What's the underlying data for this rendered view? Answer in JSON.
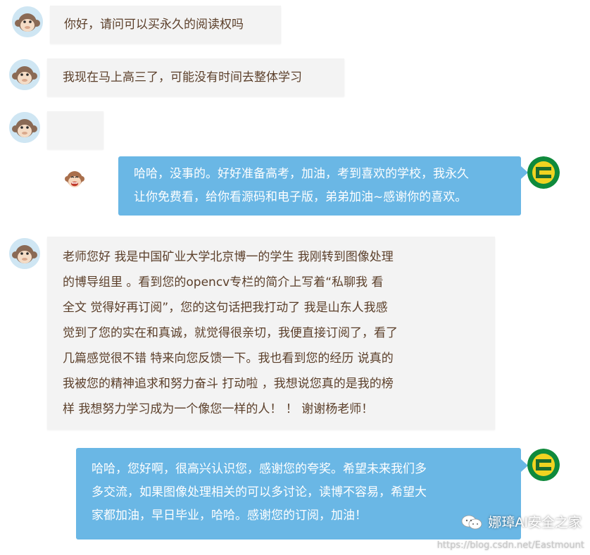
{
  "messages": [
    {
      "side": "in",
      "text": "你好，请问可以买永久的阅读权吗"
    },
    {
      "side": "in",
      "text": "我现在马上高三了，可能没有时间去整体学习"
    },
    {
      "side": "in",
      "text": "",
      "emoji": "monkey-face-emoji"
    },
    {
      "side": "out",
      "text": "哈哈，没事的。好好准备高考，加油，考到喜欢的学校，我永久\n让你免费看，给你看源码和电子版，弟弟加油~感谢你的喜欢。"
    },
    {
      "side": "in",
      "text": "老师您好 我是中国矿业大学北京博一的学生 我刚转到图像处理\n的博导组里 。看到您的opencv专栏的简介上写着“私聊我 看\n全文 觉得好再订阅”，您的这句话把我打动了 我是山东人我感\n觉到了您的实在和真诚，就觉得很亲切，我便直接订阅了，看了\n几篇感觉很不错 特来向您反馈一下。我也看到您的经历 说真的\n我被您的精神追求和努力奋斗 打动啦 ，我想说您真的是我的榜\n样 我想努力学习成为一个像您一样的人！ ！ 谢谢杨老师！"
    },
    {
      "side": "out",
      "text": "哈哈，您好啊，很高兴认识您，感谢您的夸奖。希望未来我们多\n多交流，如果图像处理相关的可以多讨论，读博不容易，希望大\n家都加油，早日毕业，哈哈。感谢您的订阅，加油！"
    }
  ],
  "watermark": {
    "account": "娜璋AI安全之家",
    "url": "https://blog.csdn.net/Eastmount"
  },
  "colors": {
    "incoming_bubble": "#f3f3f3",
    "incoming_text": "#5b3f2a",
    "outgoing_bubble": "#6ab7e5",
    "outgoing_text": "#ffffff"
  }
}
